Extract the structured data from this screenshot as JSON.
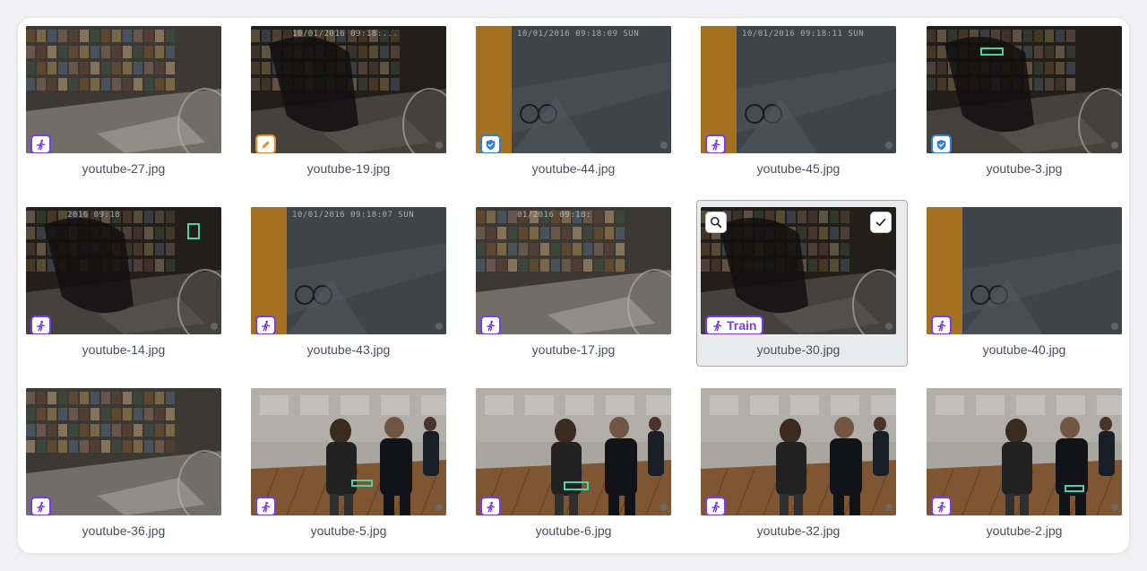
{
  "gallery": {
    "items": [
      {
        "file": "youtube-27.jpg",
        "tag": "person",
        "scene": "store"
      },
      {
        "file": "youtube-19.jpg",
        "tag": "edit",
        "scene": "storedark",
        "timestamp": "10/01/2016 09:18:..."
      },
      {
        "file": "youtube-44.jpg",
        "tag": "shield",
        "scene": "street",
        "timestamp": "10/01/2016 09:18:09 SUN"
      },
      {
        "file": "youtube-45.jpg",
        "tag": "person",
        "scene": "street",
        "timestamp": "10/01/2016 09:18:11 SUN"
      },
      {
        "file": "youtube-3.jpg",
        "tag": "shield",
        "scene": "storedark"
      },
      {
        "file": "youtube-14.jpg",
        "tag": "person",
        "scene": "storedark",
        "timestamp": "2016 09:18"
      },
      {
        "file": "youtube-43.jpg",
        "tag": "person",
        "scene": "street",
        "timestamp": "10/01/2016 09:18:07 SUN"
      },
      {
        "file": "youtube-17.jpg",
        "tag": "person",
        "scene": "store",
        "timestamp": "01/2016 09:18:"
      },
      {
        "file": "youtube-30.jpg",
        "tag": "person",
        "scene": "storedark",
        "selected": true,
        "badge_label": "Train"
      },
      {
        "file": "youtube-40.jpg",
        "tag": "person",
        "scene": "street"
      },
      {
        "file": "youtube-36.jpg",
        "tag": "person",
        "scene": "store"
      },
      {
        "file": "youtube-5.jpg",
        "tag": "person",
        "scene": "hall"
      },
      {
        "file": "youtube-6.jpg",
        "tag": "person",
        "scene": "hall"
      },
      {
        "file": "youtube-32.jpg",
        "tag": "person",
        "scene": "hall"
      },
      {
        "file": "youtube-2.jpg",
        "tag": "person",
        "scene": "hall"
      }
    ]
  },
  "colors": {
    "person_badge": "#7c3aed",
    "edit_badge": "#f08a24",
    "shield_badge": "#2f7fd8",
    "bbox": "#4fd1a5",
    "selected_bg": "#e9eaee"
  },
  "icons": {
    "person": "running-person-icon",
    "edit": "pencil-icon",
    "shield": "shield-check-icon",
    "zoom": "magnifier-icon",
    "select": "checkmark-icon"
  }
}
